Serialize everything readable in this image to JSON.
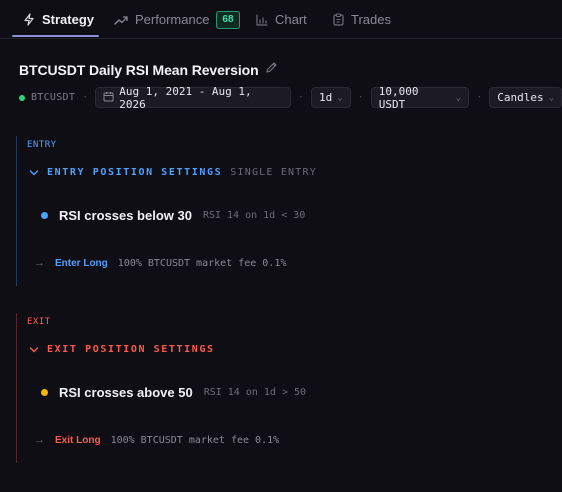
{
  "tabs": {
    "strategy": "Strategy",
    "performance": "Performance",
    "performance_badge": "68",
    "chart": "Chart",
    "trades": "Trades"
  },
  "strategy": {
    "title": "BTCUSDT Daily RSI Mean Reversion",
    "symbol": "BTCUSDT",
    "date_range": "Aug 1, 2021 - Aug 1, 2026",
    "timeframe": "1d",
    "capital": "10,000 USDT",
    "view_mode": "Candles"
  },
  "entry": {
    "label": "ENTRY",
    "heading": "ENTRY POSITION SETTINGS",
    "subheading": "SINGLE ENTRY",
    "condition": "RSI crosses below 30",
    "condition_meta": "RSI 14 on 1d < 30",
    "action_name": "Enter Long",
    "action_meta": "100% BTCUSDT market fee 0.1%"
  },
  "exit": {
    "label": "EXIT",
    "heading": "EXIT POSITION SETTINGS",
    "condition": "RSI crosses above 50",
    "condition_meta": "RSI 14 on 1d > 50",
    "action_name": "Exit Long",
    "action_meta": "100% BTCUSDT market fee 0.1%"
  },
  "colors": {
    "entry_accent": "#4ea1ff",
    "exit_accent": "#ff5a4e",
    "exit_dot": "#f5b50e",
    "badge": "#3ee0a8",
    "status_dot": "#2ed47a"
  },
  "icons": {
    "strategy": "bolt-icon",
    "performance": "trend-icon",
    "chart": "bar-chart-icon",
    "trades": "clipboard-icon",
    "edit": "pencil-icon",
    "calendar": "calendar-icon"
  }
}
